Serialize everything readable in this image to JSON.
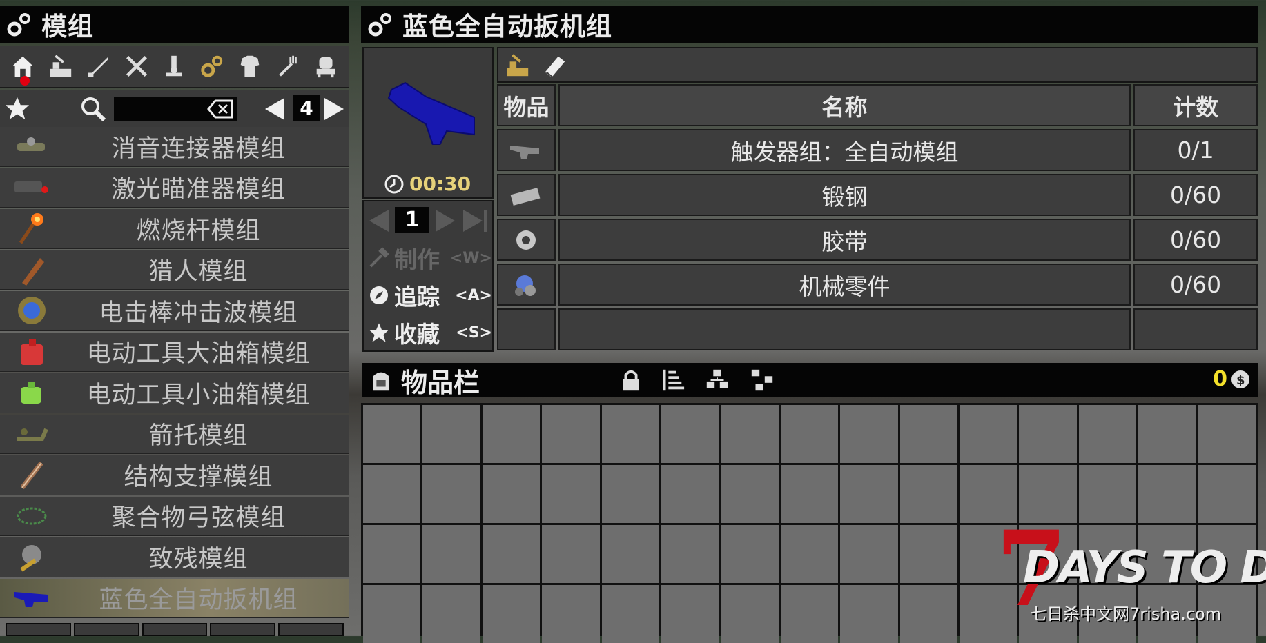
{
  "left_panel": {
    "title": "模组",
    "categories": [
      "home",
      "forge",
      "weapons",
      "tools",
      "science",
      "mods",
      "armor",
      "food",
      "furniture"
    ],
    "page": "4",
    "recipes": [
      {
        "label": "消音连接器模组"
      },
      {
        "label": "激光瞄准器模组"
      },
      {
        "label": "燃烧杆模组"
      },
      {
        "label": "猎人模组"
      },
      {
        "label": "电击棒冲击波模组"
      },
      {
        "label": "电动工具大油箱模组"
      },
      {
        "label": "电动工具小油箱模组"
      },
      {
        "label": "箭托模组"
      },
      {
        "label": "结构支撑模组"
      },
      {
        "label": "聚合物弓弦模组"
      },
      {
        "label": "致残模组"
      },
      {
        "label": "蓝色全自动扳机组"
      }
    ]
  },
  "info_panel": {
    "title": "蓝色全自动扳机组",
    "craft_time": "00:30",
    "quantity": "1",
    "actions": [
      {
        "label": "制作",
        "key": "<W>"
      },
      {
        "label": "追踪",
        "key": "<A>"
      },
      {
        "label": "收藏",
        "key": "<S>"
      }
    ]
  },
  "ingredients": {
    "headers": {
      "item": "物品",
      "name": "名称",
      "count": "计数"
    },
    "rows": [
      {
        "name": "触发器组：全自动模组",
        "count": "0/1"
      },
      {
        "name": "锻钢",
        "count": "0/60"
      },
      {
        "name": "胶带",
        "count": "0/60"
      },
      {
        "name": "机械零件",
        "count": "0/60"
      }
    ]
  },
  "inventory": {
    "title": "物品栏",
    "coins": "0"
  },
  "watermark": {
    "title": "DAYS TO DIE",
    "seven": "7",
    "sub": "七日杀中文网7risha.com"
  },
  "colors": {
    "selected": "#8a8266",
    "timer": "#e6d27a",
    "coin": "#f4e02a",
    "notify": "#e00010"
  }
}
